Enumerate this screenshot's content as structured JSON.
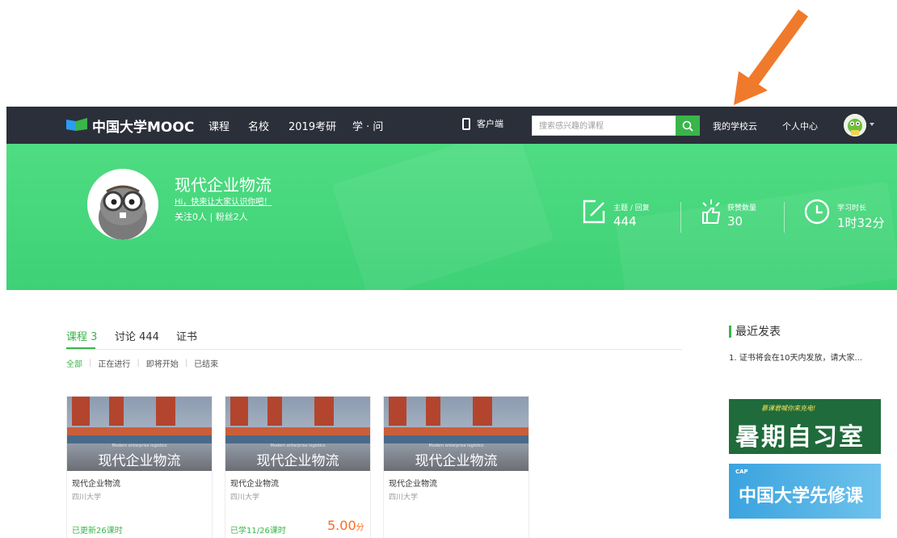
{
  "colors": {
    "nav_bg": "#2b2f3a",
    "banner_green": "#3ed176",
    "accent_green": "#39b54a",
    "score_orange": "#ff6a1a",
    "arrow_orange": "#f07a2b"
  },
  "nav": {
    "logo_text": "中国大学MOOC",
    "links": [
      "课程",
      "名校",
      "2019考研",
      "学 · 问"
    ],
    "client_label": "客户端",
    "search_placeholder": "搜索感兴趣的课程",
    "school_cloud": "我的学校云",
    "personal_center": "个人中心"
  },
  "profile": {
    "name": "现代企业物流",
    "hello": "Hi，快来让大家认识你吧！",
    "follow": "关注0人 | 粉丝2人",
    "stats": [
      {
        "label": "主题 / 回复",
        "value": "444",
        "icon": "edit-icon"
      },
      {
        "label": "获赞数量",
        "value": "30",
        "icon": "thumbs-up-icon"
      },
      {
        "label": "学习时长",
        "value": "1时32分",
        "icon": "clock-icon"
      }
    ]
  },
  "tabs": [
    "课程 3",
    "讨论 444",
    "证书"
  ],
  "filters": [
    "全部",
    "正在进行",
    "即将开始",
    "已结束"
  ],
  "courses": [
    {
      "thumb_sub": "Modern enterprise logistics",
      "thumb_title": "现代企业物流",
      "title": "现代企业物流",
      "school": "四川大学",
      "progress": "已更新26课时",
      "score": "",
      "score_unit": ""
    },
    {
      "thumb_sub": "Modern enterprise logistics",
      "thumb_title": "现代企业物流",
      "title": "现代企业物流",
      "school": "四川大学",
      "progress": "已学11/26课时",
      "score": "5.00",
      "score_unit": "分"
    },
    {
      "thumb_sub": "Modern enterprise logistics",
      "thumb_title": "现代企业物流",
      "title": "现代企业物流",
      "school": "四川大学",
      "progress": "",
      "score": "",
      "score_unit": ""
    }
  ],
  "sidebar": {
    "recent_title": "最近发表",
    "recent_items": [
      "1. 证书将会在10天内发放，请大家..."
    ],
    "promo1_small": "慕课君喊你来充电!",
    "promo1_big": "暑期自习室",
    "promo2_cap": "CAP",
    "promo2_big": "中国大学先修课"
  }
}
